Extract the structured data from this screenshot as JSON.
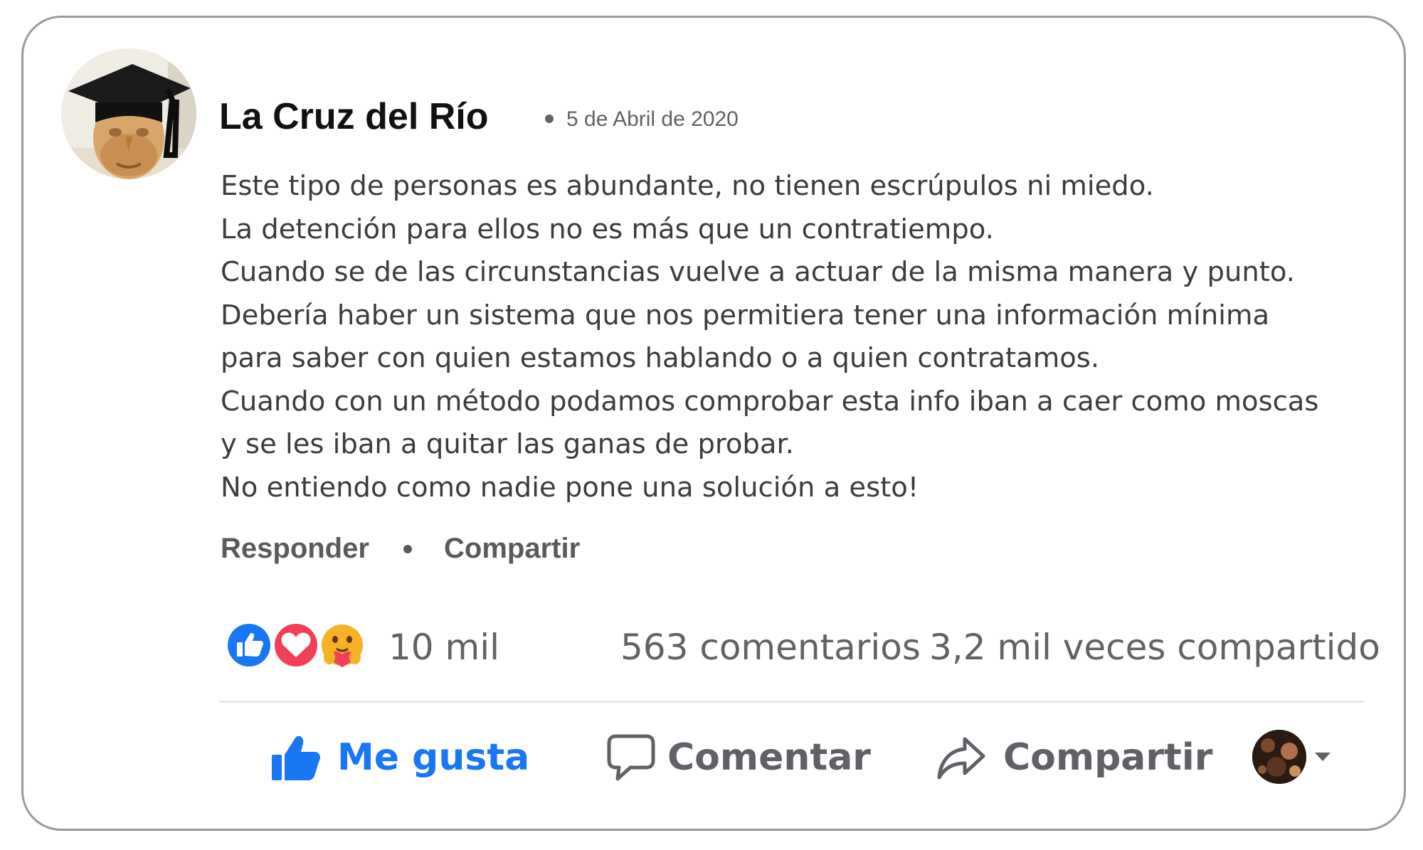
{
  "comment": {
    "author": "La Cruz del Río",
    "date": "5 de Abril de 2020",
    "body_lines": [
      "Este tipo de personas es abundante, no tienen escrúpulos ni miedo.",
      "La detención para ellos no es más que un contratiempo.",
      "Cuando se de las circunstancias vuelve a actuar de la misma manera y punto.",
      "Debería haber un sistema que nos permitiera tener una información mínima",
      "para saber con quien estamos hablando o a quien contratamos.",
      "Cuando con un método podamos comprobar esta info iban a caer como moscas",
      "y se les iban a quitar las ganas de probar.",
      "No entiendo como nadie pone una solución a esto!"
    ],
    "actions": {
      "reply": "Responder",
      "share": "Compartir"
    }
  },
  "stats": {
    "reactions": [
      "like-reaction-icon",
      "love-reaction-icon",
      "care-reaction-icon"
    ],
    "reaction_count": "10 mil",
    "comments": "563 comentarios",
    "shares": "3,2 mil veces compartido"
  },
  "action_bar": {
    "like": "Me gusta",
    "comment": "Comentar",
    "share": "Compartir"
  },
  "colors": {
    "brand_blue": "#1877f2",
    "love_red": "#f33e58",
    "muted_text": "#606266",
    "card_border": "#9a9a9a"
  }
}
